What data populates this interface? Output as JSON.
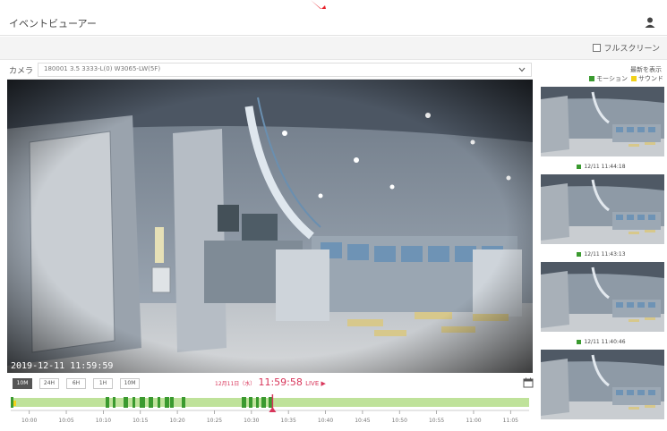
{
  "header": {
    "title": "イベントビューアー"
  },
  "toolbar": {
    "fullscreen_label": "フルスクリーン"
  },
  "camera": {
    "label": "カメラ",
    "selected": "180001 3.5 3333-L(0) W3065-LW(5F)"
  },
  "video": {
    "osd_timestamp": "2019-12-11  11:59:59"
  },
  "controls": {
    "ranges": [
      "10M",
      "24H",
      "6H",
      "1H",
      "10M"
    ],
    "active_range_index": 0,
    "live_date": "12月11日（水）",
    "live_time": "11:59:58",
    "live_label": "LIVE ▶"
  },
  "timeline": {
    "tick_labels": [
      "10:00",
      "10:05",
      "10:10",
      "10:15",
      "10:20",
      "10:25",
      "10:30",
      "10:35",
      "10:40",
      "10:45",
      "10:50",
      "10:55",
      "11:00",
      "11:05"
    ],
    "position_fraction": 0.505,
    "colors": {
      "motion": "#3a9a2f",
      "sound": "#f2d21a",
      "recorded": "#bfe29a",
      "playhead": "#d8355a"
    }
  },
  "sidebar": {
    "legend_title": "最新を表示",
    "legend_motion": "モーション",
    "legend_sound": "サウンド",
    "thumbnails": [
      {
        "time": "12/11 11:44:18"
      },
      {
        "time": "12/11 11:43:13"
      },
      {
        "time": "12/11 11:40:46"
      },
      {
        "time": ""
      }
    ]
  },
  "icons": {
    "user": "user-icon",
    "calendar": "calendar-icon",
    "chevron": "chevron-down-icon"
  }
}
